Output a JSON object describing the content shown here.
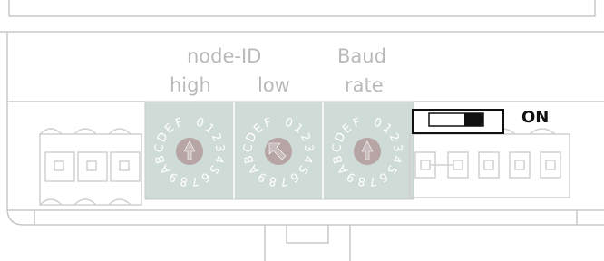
{
  "labels": {
    "node_id": "node-ID",
    "high": "high",
    "low": "low",
    "baud": "Baud",
    "rate": "rate",
    "on": "ON"
  },
  "rotary_switches": [
    {
      "name": "node-id-high",
      "digits": "0123456789ABCDEF"
    },
    {
      "name": "node-id-low",
      "digits": "0123456789ABCDEF"
    },
    {
      "name": "baud-rate",
      "digits": "0123456789ABCDEF"
    }
  ],
  "dip_switch": {
    "state": "ON"
  },
  "colors": {
    "outline": "#c8c8c8",
    "rotary_bg": "#cfdbd6",
    "knob": "#b7a5a5",
    "label": "#b9b9b9"
  }
}
